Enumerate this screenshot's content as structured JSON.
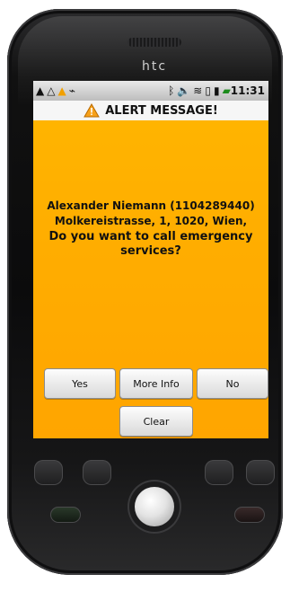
{
  "device": {
    "brand": "htc"
  },
  "status_bar": {
    "icons": [
      "warning-black-icon",
      "warning-black-icon",
      "warning-yellow-icon",
      "usb-icon",
      "bluetooth-icon",
      "mute-icon",
      "wifi-icon",
      "vibrate-icon",
      "signal-icon",
      "battery-icon"
    ],
    "time": "11:31"
  },
  "dialog": {
    "title": "ALERT MESSAGE!",
    "contact_line": "Alexander Niemann  (1104289440)",
    "address_line": "Molkereistrasse,  1,  1020, Wien,",
    "question": "Do you want to call emergency services?",
    "buttons": {
      "yes": "Yes",
      "more_info": "More Info",
      "no": "No",
      "clear": "Clear"
    }
  },
  "colors": {
    "background": "#ffad00",
    "accent_warning": "#f7a11a"
  }
}
